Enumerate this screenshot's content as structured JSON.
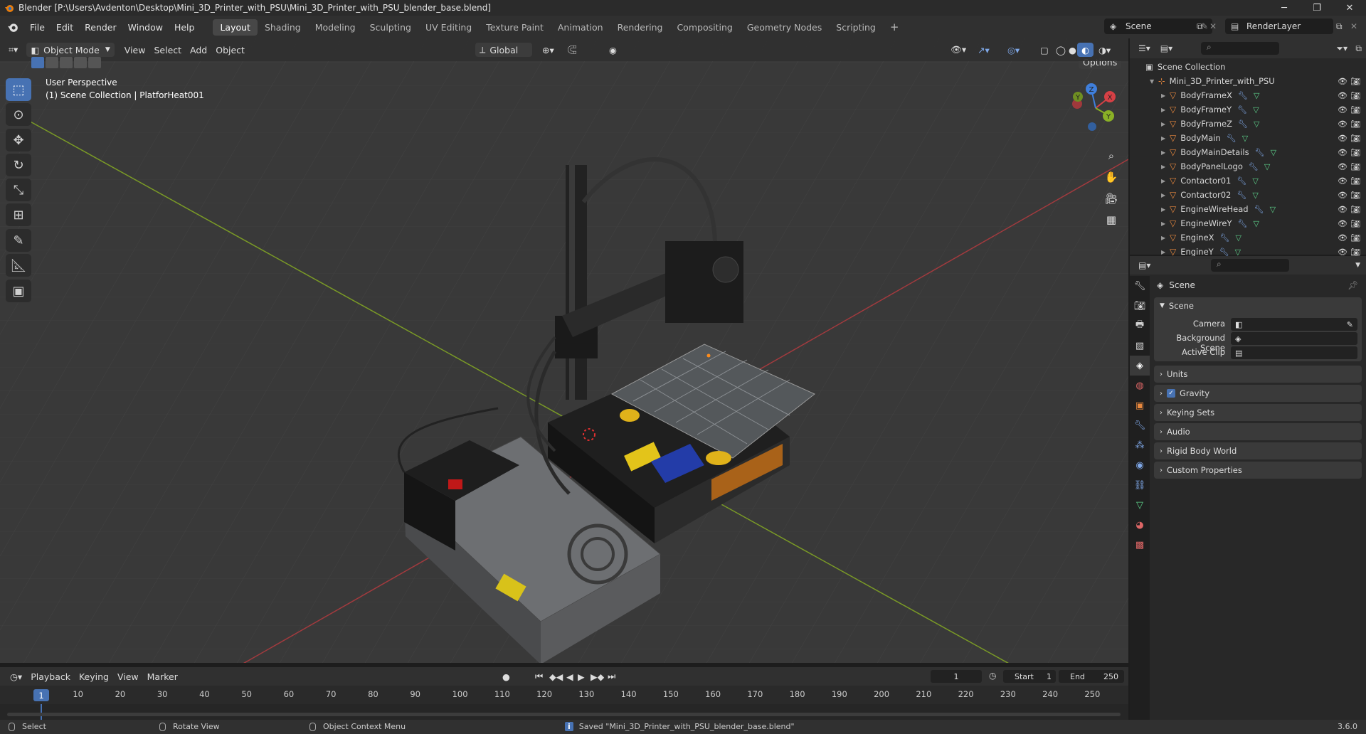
{
  "window": {
    "title": "Blender [P:\\Users\\Avdenton\\Desktop\\Mini_3D_Printer_with_PSU\\Mini_3D_Printer_with_PSU_blender_base.blend]",
    "min": "─",
    "max": "❐",
    "close": "✕"
  },
  "menu": [
    "File",
    "Edit",
    "Render",
    "Window",
    "Help"
  ],
  "workspaces": [
    "Layout",
    "Shading",
    "Modeling",
    "Sculpting",
    "UV Editing",
    "Texture Paint",
    "Animation",
    "Rendering",
    "Compositing",
    "Geometry Nodes",
    "Scripting"
  ],
  "active_workspace": "Layout",
  "scene_name": "Scene",
  "render_layer": "RenderLayer",
  "viewport": {
    "mode": "Object Mode",
    "menus": [
      "View",
      "Select",
      "Add",
      "Object"
    ],
    "orientation": "Global",
    "options": "Options",
    "perspective": "User Perspective",
    "collection_info": "(1) Scene Collection | PlatforHeat001",
    "axes": {
      "x": "X",
      "y": "Y",
      "z": "Z"
    }
  },
  "outliner": {
    "scene_collection": "Scene Collection",
    "collection": "Mini_3D_Printer_with_PSU",
    "items": [
      "BodyFrameX",
      "BodyFrameY",
      "BodyFrameZ",
      "BodyMain",
      "BodyMainDetails",
      "BodyPanelLogo",
      "Contactor01",
      "Contactor02",
      "EngineWireHead",
      "EngineWireY",
      "EngineX",
      "EngineY"
    ]
  },
  "properties": {
    "header": "Scene",
    "panel_title": "Scene",
    "camera_label": "Camera",
    "bg_scene_label": "Background Scene",
    "active_clip_label": "Active Clip",
    "sections": [
      "Units",
      "Gravity",
      "Keying Sets",
      "Audio",
      "Rigid Body World",
      "Custom Properties"
    ]
  },
  "timeline": {
    "menus": [
      "Playback",
      "Keying",
      "View",
      "Marker"
    ],
    "current_frame": "1",
    "start_label": "Start",
    "start": "1",
    "end_label": "End",
    "end": "250",
    "ticks": [
      "1",
      "10",
      "20",
      "30",
      "40",
      "50",
      "60",
      "70",
      "80",
      "90",
      "100",
      "110",
      "120",
      "130",
      "140",
      "150",
      "160",
      "170",
      "180",
      "190",
      "200",
      "210",
      "220",
      "230",
      "240",
      "250"
    ]
  },
  "status": {
    "select": "Select",
    "rotate": "Rotate View",
    "context": "Object Context Menu",
    "message": "Saved \"Mini_3D_Printer_with_PSU_blender_base.blend\"",
    "version": "3.6.0"
  },
  "colors": {
    "accent": "#4772b3",
    "object_orange": "#e8883e",
    "x_axis": "#d64045",
    "y_axis": "#8ab026",
    "z_axis": "#3f7fdc"
  }
}
